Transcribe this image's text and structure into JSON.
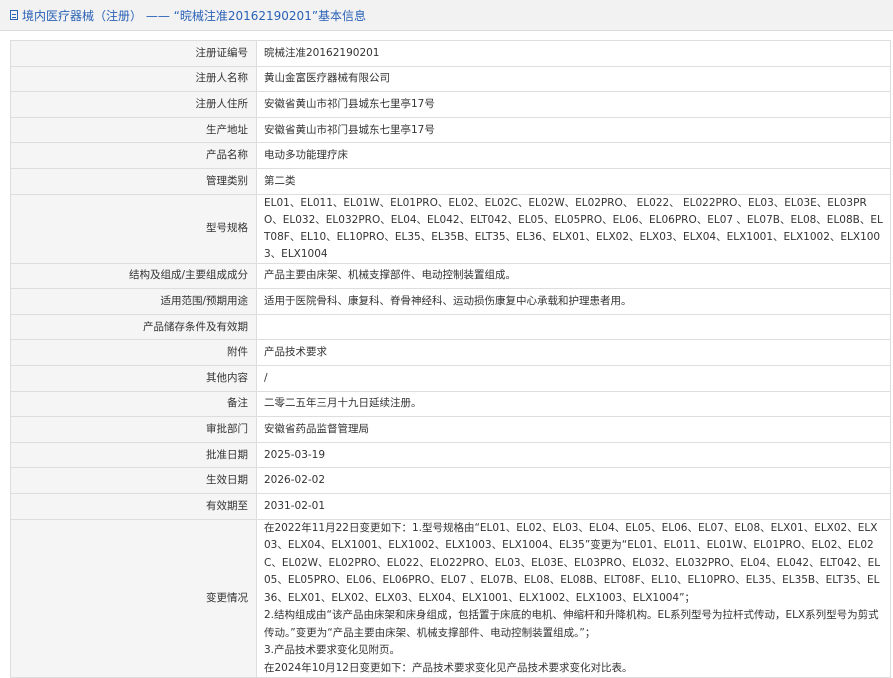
{
  "header": {
    "title": "境内医疗器械（注册） —— “晥械注准20162190201”基本信息"
  },
  "rows": [
    {
      "label": "注册证编号",
      "value": "晥械注准20162190201"
    },
    {
      "label": "注册人名称",
      "value": "黄山金富医疗器械有限公司"
    },
    {
      "label": "注册人住所",
      "value": "安徽省黄山市祁门县城东七里亭17号"
    },
    {
      "label": "生产地址",
      "value": "安徽省黄山市祁门县城东七里亭17号"
    },
    {
      "label": "产品名称",
      "value": "电动多功能理疗床"
    },
    {
      "label": "管理类别",
      "value": "第二类"
    },
    {
      "label": "型号规格",
      "value": "EL01、EL011、EL01W、EL01PRO、EL02、EL02C、EL02W、EL02PRO、 EL022、 EL022PRO、EL03、EL03E、EL03PRO、EL032、EL032PRO、EL04、EL042、ELT042、EL05、EL05PRO、EL06、EL06PRO、EL07 、EL07B、EL08、EL08B、ELT08F、EL10、EL10PRO、EL35、EL35B、ELT35、EL36、ELX01、ELX02、ELX03、ELX04、ELX1001、ELX1002、ELX1003、ELX1004"
    },
    {
      "label": "结构及组成/主要组成成分",
      "value": "产品主要由床架、机械支撑部件、电动控制装置组成。"
    },
    {
      "label": "适用范围/预期用途",
      "value": "适用于医院骨科、康复科、脊骨神经科、运动损伤康复中心承载和护理患者用。"
    },
    {
      "label": "产品储存条件及有效期",
      "value": ""
    },
    {
      "label": "附件",
      "value": "产品技术要求"
    },
    {
      "label": "其他内容",
      "value": "/"
    },
    {
      "label": "备注",
      "value": "二零二五年三月十九日延续注册。"
    },
    {
      "label": "审批部门",
      "value": "安徽省药品监督管理局"
    },
    {
      "label": "批准日期",
      "value": "2025-03-19"
    },
    {
      "label": "生效日期",
      "value": "2026-02-02"
    },
    {
      "label": "有效期至",
      "value": "2031-02-01"
    }
  ],
  "change": {
    "label": "变更情况",
    "lines": [
      "在2022年11月22日变更如下：1.型号规格由“EL01、EL02、EL03、EL04、EL05、EL06、EL07、EL08、ELX01、ELX02、ELX03、ELX04、ELX1001、ELX1002、ELX1003、ELX1004、EL35”变更为“EL01、EL011、EL01W、EL01PRO、EL02、EL02C、EL02W、EL02PRO、EL022、EL022PRO、EL03、EL03E、EL03PRO、EL032、EL032PRO、EL04、EL042、ELT042、EL05、EL05PRO、EL06、EL06PRO、EL07 、EL07B、EL08、EL08B、ELT08F、EL10、EL10PRO、EL35、EL35B、ELT35、EL36、ELX01、ELX02、ELX03、ELX04、ELX1001、ELX1002、ELX1003、ELX1004”；",
      "2.结构组成由“该产品由床架和床身组成，包括置于床底的电机、伸缩杆和升降机构。EL系列型号为拉杆式传动，ELX系列型号为剪式传动。”变更为“产品主要由床架、机械支撑部件、电动控制装置组成。”；",
      "3.产品技术要求变化见附页。",
      "在2024年10月12日变更如下：产品技术要求变化见产品技术要求变化对比表。"
    ]
  }
}
